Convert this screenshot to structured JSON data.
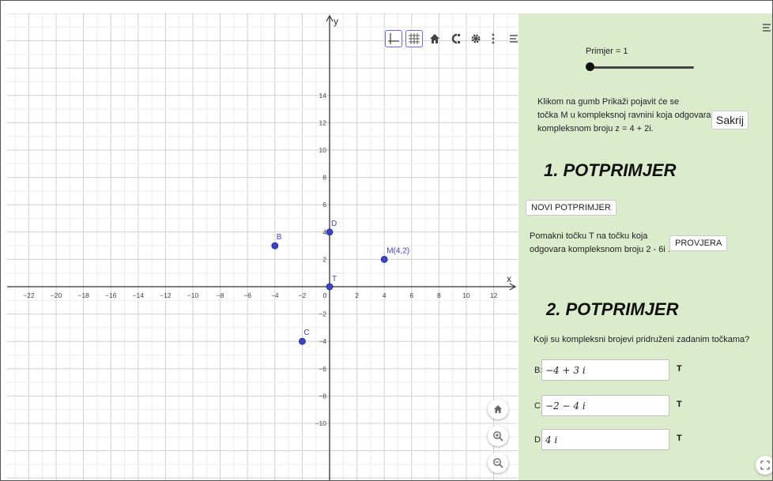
{
  "graph": {
    "y_axis_label": "y",
    "x_axis_label": "x",
    "x_ticks": [
      "-22",
      "-20",
      "-18",
      "-16",
      "-14",
      "-12",
      "-10",
      "-8",
      "-6",
      "-4",
      "-2",
      "0",
      "2",
      "4",
      "6",
      "8",
      "10",
      "12"
    ],
    "y_ticks": [
      "14",
      "12",
      "10",
      "8",
      "6",
      "4",
      "2",
      "-2",
      "-4",
      "-6",
      "-8",
      "-10"
    ],
    "points": [
      {
        "label": "B",
        "x": -4,
        "y": 3
      },
      {
        "label": "D",
        "x": 0,
        "y": 4
      },
      {
        "label": "M(4,2)",
        "x": 4,
        "y": 2
      },
      {
        "label": "T",
        "x": 0,
        "y": 0
      },
      {
        "label": "C",
        "x": -2,
        "y": -4
      }
    ],
    "point_color": "#3d44c8",
    "toolbar_icons": [
      "axes-icon",
      "grid-icon",
      "home-icon",
      "magnet-icon",
      "gear-icon",
      "more-icon",
      "style-bar-icon"
    ],
    "zoom_buttons": [
      "home-icon",
      "zoom-in-icon",
      "zoom-out-icon"
    ]
  },
  "panel": {
    "slider_label": "Primjer = 1",
    "slider_value": 1,
    "intro_lines": [
      "Klikom na gumb Prikaži pojavit će se",
      "točka M u kompleksnoj ravnini koja odgovara",
      "kompleksnom broju z = 4 + 2i."
    ],
    "hide_button": "Sakrij",
    "heading1": "1. POTPRIMJER",
    "new_example_button": "NOVI POTPRIMJER",
    "task_lines": [
      "Pomakni točku T na točku koja",
      "odgovara kompleksnom broju 2 - 6i ."
    ],
    "check_button": "PROVJERA",
    "heading2": "2. POTPRIMJER",
    "question": "Koji su kompleksni brojevi pridruženi zadanim točkama?",
    "answers": [
      {
        "label": "B:",
        "value": "−4 + 3 i",
        "mark": "T"
      },
      {
        "label": "C:",
        "value": "−2 − 4 i",
        "mark": "T"
      },
      {
        "label": "D:",
        "value": "4 i",
        "mark": "T"
      }
    ],
    "background": "#dbeccd"
  }
}
